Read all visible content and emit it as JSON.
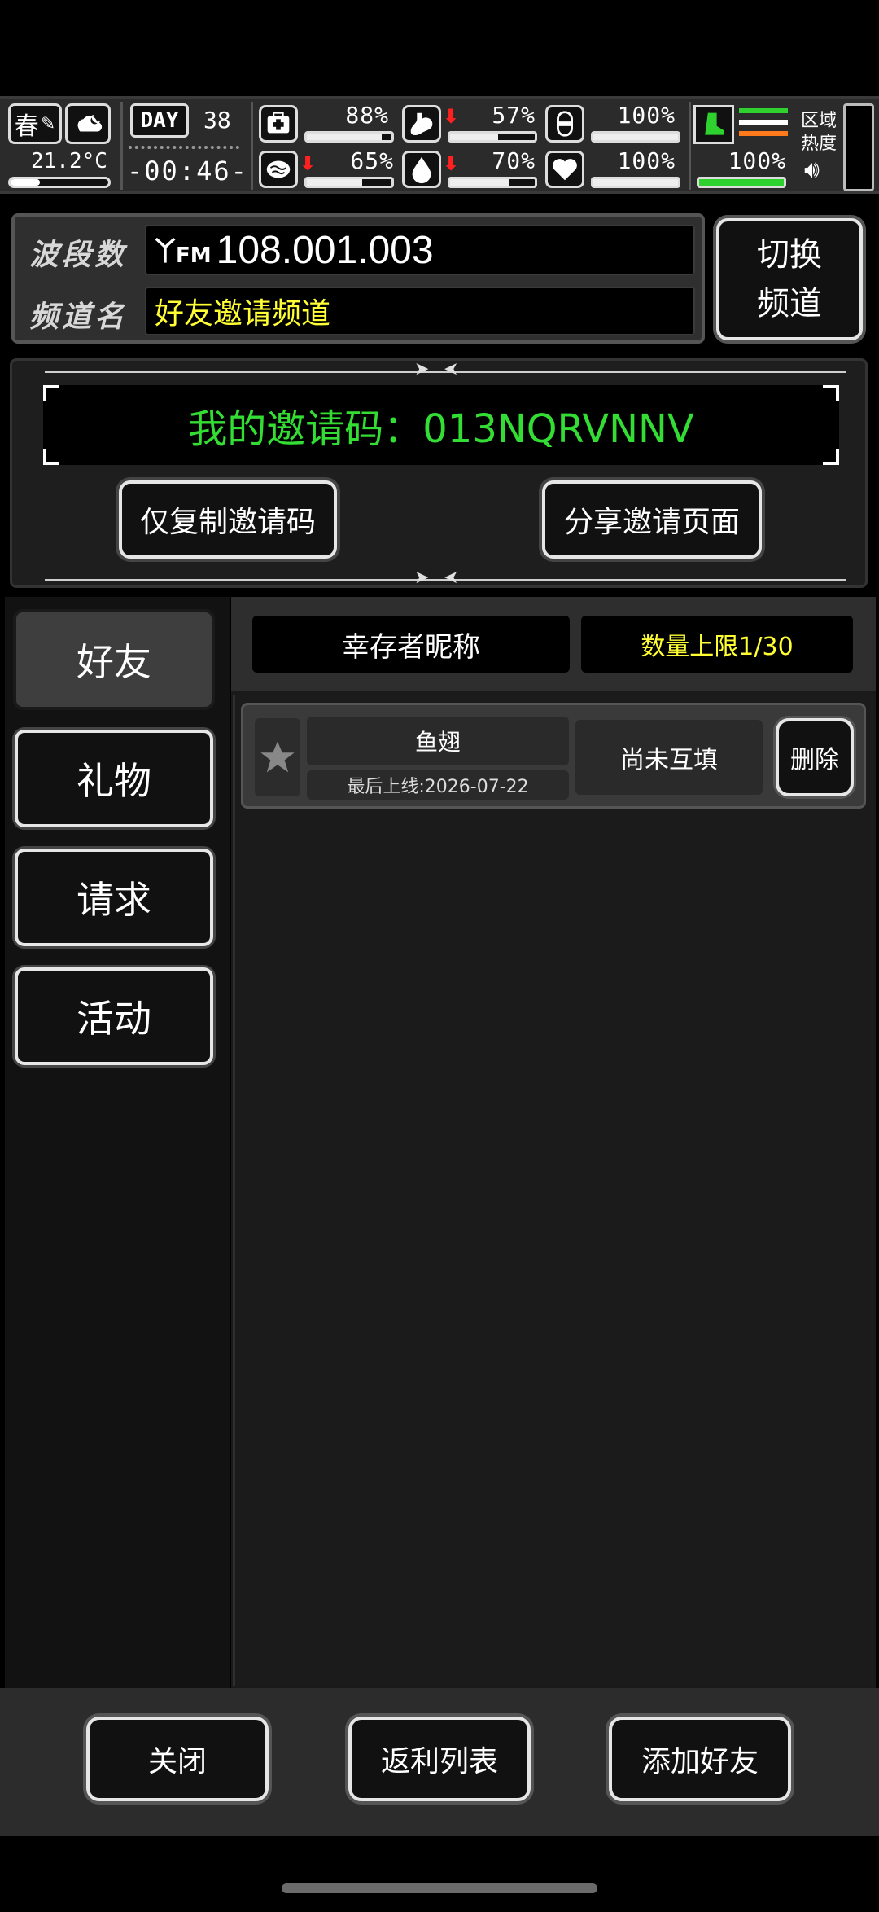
{
  "hud": {
    "season": "春",
    "temperature": "21.2°C",
    "day_label": "DAY",
    "day": "38",
    "clock": "-00:46-",
    "stats": [
      {
        "name": "health",
        "value": "88%",
        "level": 0.88,
        "down": false
      },
      {
        "name": "hunger",
        "value": "57%",
        "level": 0.57,
        "down": true
      },
      {
        "name": "medicine",
        "value": "100%",
        "level": 1.0,
        "down": false
      },
      {
        "name": "mind",
        "value": "65%",
        "level": 0.65,
        "down": true
      },
      {
        "name": "thirst",
        "value": "70%",
        "level": 0.7,
        "down": true
      },
      {
        "name": "heart",
        "value": "100%",
        "level": 1.0,
        "down": false
      }
    ],
    "stamina": {
      "value": "100%",
      "level": 1.0
    },
    "zone_label": "区域\n热度",
    "accent_green": "#2fd12f",
    "arrow_red": "#ff2020"
  },
  "radio": {
    "band_label": "波段数",
    "band_value": "108.001.003",
    "fm_mark": "FM",
    "channel_label": "频道名",
    "channel_value": "好友邀请频道",
    "switch_label": "切换\n频道"
  },
  "invite": {
    "code_text": "我的邀请码：013NQRVNNV",
    "copy_button": "仅复制邀请码",
    "share_button": "分享邀请页面"
  },
  "tabs": [
    {
      "label": "好友",
      "active": true
    },
    {
      "label": "礼物",
      "active": false
    },
    {
      "label": "请求",
      "active": false
    },
    {
      "label": "活动",
      "active": false
    }
  ],
  "list_header": {
    "nickname_label": "幸存者昵称",
    "limit_label": "数量上限1/30",
    "limit_color": "#ffff33"
  },
  "friends": [
    {
      "name": "鱼翅",
      "last_online": "最后上线:2026-07-22",
      "status": "尚未互填",
      "delete_label": "删除"
    }
  ],
  "bottom": {
    "close": "关闭",
    "rebate": "返利列表",
    "add_friend": "添加好友"
  }
}
